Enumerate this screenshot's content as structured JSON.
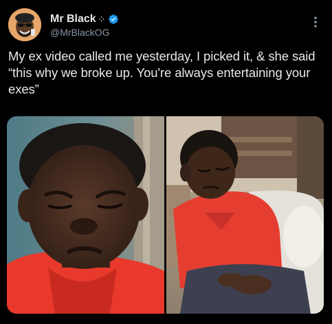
{
  "post": {
    "author": {
      "display_name": "Mr Black",
      "name_glyph": "⁘",
      "handle": "@MrBlackOG",
      "verified": true
    },
    "text": "My ex video called me yesterday, I picked it, & she said “this why we broke up. You're always entertaining your exes”",
    "media_count": 2
  },
  "icons": {
    "verified": "verified-badge-icon",
    "more": "more-options-icon"
  },
  "colors": {
    "background": "#000000",
    "text_primary": "#e7e9ea",
    "text_secondary": "#8b98a5",
    "verified_blue": "#1d9bf0"
  }
}
